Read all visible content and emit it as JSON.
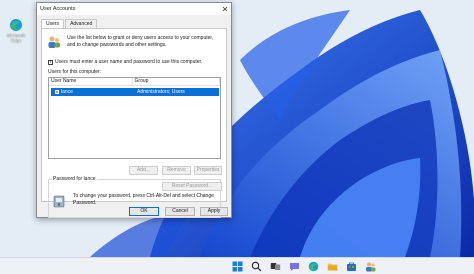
{
  "desktop": {
    "edge_label": "Microsoft Edge"
  },
  "dialog": {
    "title": "User Accounts",
    "close_label": "✕",
    "tabs": [
      {
        "label": "Users",
        "active": true
      },
      {
        "label": "Advanced",
        "active": false
      }
    ],
    "intro_text": "Use the list below to grant or deny users access to your computer, and to change passwords and other settings.",
    "checkbox": {
      "label": "Users must enter a user name and password to use this computer.",
      "checked": true
    },
    "users_group_label": "Users for this computer:",
    "list": {
      "columns": [
        "User Name",
        "Group"
      ],
      "rows": [
        {
          "user": "lance",
          "group": "Administrators; Users",
          "selected": true
        }
      ]
    },
    "buttons": {
      "add": "Add...",
      "remove": "Remove",
      "properties": "Properties",
      "reset_password": "Reset Password...",
      "ok": "OK",
      "cancel": "Cancel",
      "apply": "Apply"
    },
    "password_group": {
      "legend": "Password for lance",
      "text": "To change your password, press Ctrl-Alt-Del and select Change Password."
    }
  },
  "taskbar": {
    "icons": [
      "windows-start-icon",
      "search-icon",
      "task-view-icon",
      "chat-icon",
      "edge-icon",
      "file-explorer-icon",
      "store-icon",
      "user-accounts-icon"
    ]
  },
  "colors": {
    "selection": "#0a6fd8",
    "wallpaper_blue": "#1a4fd6"
  }
}
